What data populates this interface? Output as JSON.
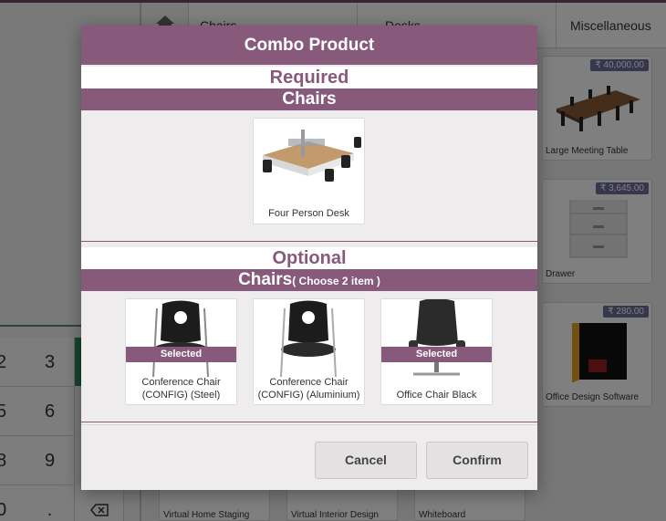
{
  "background": {
    "categories": [
      "Chairs",
      "Desks",
      "Miscellaneous"
    ],
    "products": [
      {
        "name": "Large Meeting Table",
        "price": "₹ 40,000.00"
      },
      {
        "name": "Drawer",
        "price": "₹ 3,645.00"
      },
      {
        "name": "Office Design Software",
        "price": "₹ 280.00"
      }
    ],
    "bottom_products": [
      "Virtual Home Staging",
      "Virtual Interior Design",
      "Whiteboard"
    ],
    "numpad": {
      "row1": [
        "2",
        "3"
      ],
      "row2": [
        "5",
        "6"
      ],
      "row3": [
        "8",
        "9"
      ],
      "row4": [
        "0",
        "."
      ]
    }
  },
  "modal": {
    "title": "Combo Product",
    "required": {
      "heading": "Required",
      "category": "Chairs",
      "items": [
        {
          "name": "Four Person Desk"
        }
      ]
    },
    "optional": {
      "heading": "Optional",
      "category": "Chairs",
      "note": "( Choose 2 item )",
      "items": [
        {
          "name_line1": "Conference Chair",
          "name_line2": "(CONFIG) (Steel)",
          "badge": "Selected"
        },
        {
          "name_line1": "Conference Chair",
          "name_line2": "(CONFIG) (Aluminium)",
          "badge": ""
        },
        {
          "name_line1": "Office Chair Black",
          "name_line2": "",
          "badge": "Selected"
        }
      ]
    },
    "buttons": {
      "cancel": "Cancel",
      "confirm": "Confirm"
    }
  },
  "colors": {
    "brand": "#875a7b",
    "price_badge": "#6d6f9b",
    "overlay": "rgba(0,0,0,0.5)"
  }
}
